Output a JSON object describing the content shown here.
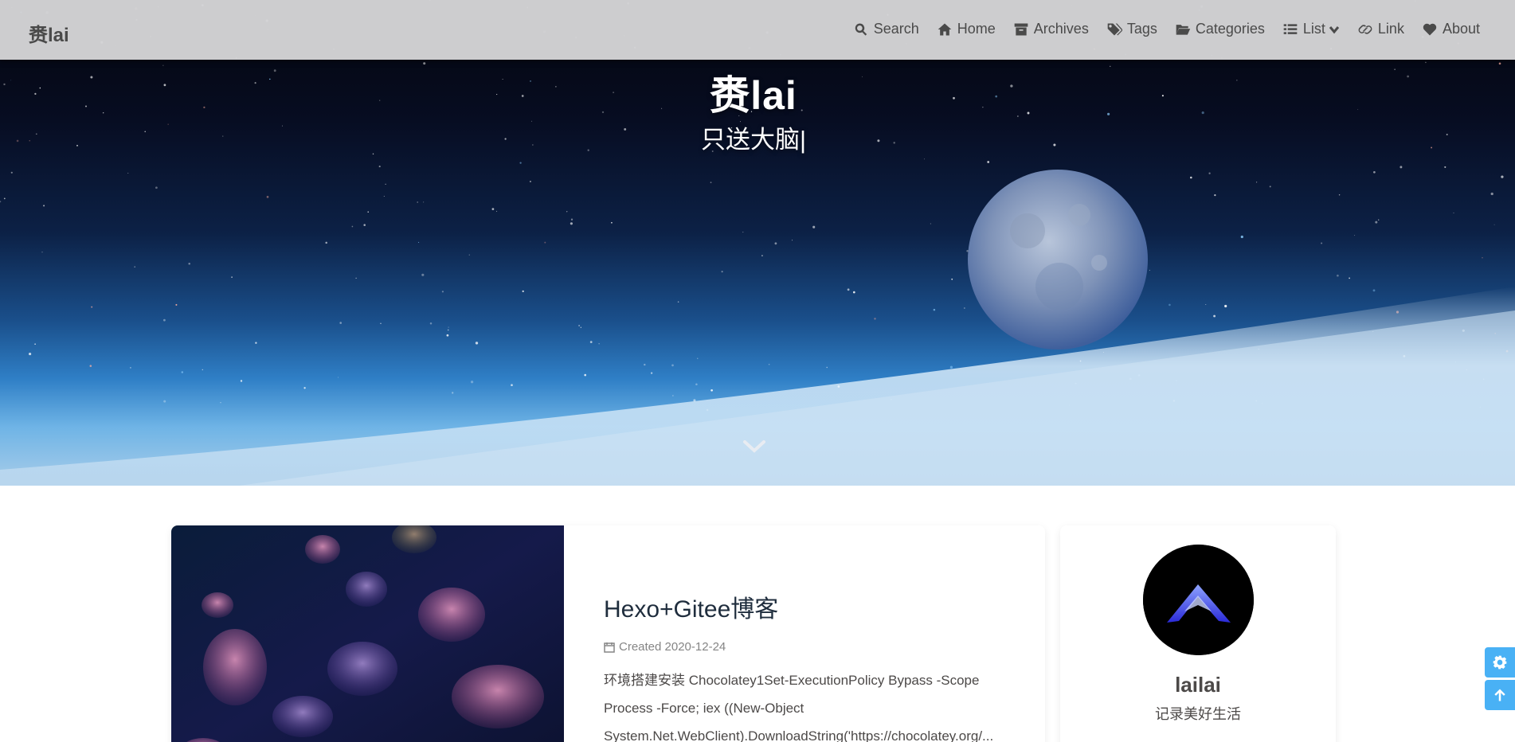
{
  "nav": {
    "brand": "赉lai",
    "menu": [
      {
        "label": "Search",
        "icon": "search-icon"
      },
      {
        "label": "Home",
        "icon": "home-icon"
      },
      {
        "label": "Archives",
        "icon": "archive-icon"
      },
      {
        "label": "Tags",
        "icon": "tags-icon"
      },
      {
        "label": "Categories",
        "icon": "folder-open-icon"
      },
      {
        "label": "List",
        "icon": "list-icon"
      },
      {
        "label": "Link",
        "icon": "link-icon"
      },
      {
        "label": "About",
        "icon": "heart-icon"
      }
    ]
  },
  "hero": {
    "title": "赉lai",
    "subtitle": "只送大脑|"
  },
  "post": {
    "title": "Hexo+Gitee博客",
    "meta": "Created 2020-12-24",
    "excerpt": "环境搭建安装 Chocolatey1Set-ExecutionPolicy Bypass -Scope Process -Force; iex ((New-Object System.Net.WebClient).DownloadString('https://chocolatey.org/..."
  },
  "author": {
    "name": "lailai",
    "description": "记录美好生活"
  },
  "colors": {
    "accent": "#49b1f5",
    "nav_bg": "#d4d4d6",
    "title": "#1f2d3d"
  },
  "right_buttons": [
    "gear-icon",
    "arrow-up-icon"
  ]
}
